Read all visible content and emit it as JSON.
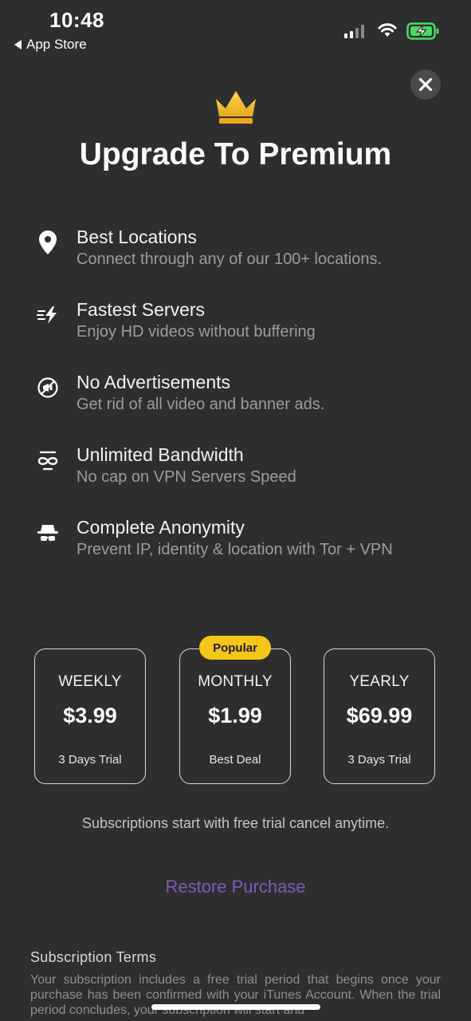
{
  "status_bar": {
    "time": "10:48",
    "back_label": "App Store"
  },
  "header": {
    "close_icon": "close-icon",
    "crown_icon": "crown-icon",
    "title": "Upgrade To Premium"
  },
  "features": [
    {
      "icon": "location-pin-icon",
      "title": "Best Locations",
      "desc": "Connect through any of our 100+ locations."
    },
    {
      "icon": "fast-bolt-icon",
      "title": "Fastest Servers",
      "desc": "Enjoy HD videos without buffering"
    },
    {
      "icon": "no-ads-icon",
      "title": "No Advertisements",
      "desc": "Get rid of all video and banner ads."
    },
    {
      "icon": "infinity-icon",
      "title": "Unlimited Bandwidth",
      "desc": "No cap on VPN Servers Speed"
    },
    {
      "icon": "incognito-icon",
      "title": "Complete Anonymity",
      "desc": "Prevent IP, identity & location with Tor + VPN"
    }
  ],
  "plans": [
    {
      "name": "WEEKLY",
      "price": "$3.99",
      "note": "3 Days Trial"
    },
    {
      "name": "MONTHLY",
      "price": "$1.99",
      "note": "Best Deal",
      "badge": "Popular"
    },
    {
      "name": "YEARLY",
      "price": "$69.99",
      "note": "3 Days Trial"
    }
  ],
  "subscription_note": "Subscriptions start with free trial cancel anytime.",
  "restore_label": "Restore Purchase",
  "terms": {
    "heading": "Subscription Terms",
    "body": "Your subscription includes a free trial period that begins once your purchase has been confirmed with your iTunes Account. When the trial period concludes, your subscription will start and"
  },
  "colors": {
    "background": "#2e2e2e",
    "accent_gold": "#f5c518",
    "restore_purple": "#7f5bb3",
    "battery_green": "#4cd964"
  }
}
